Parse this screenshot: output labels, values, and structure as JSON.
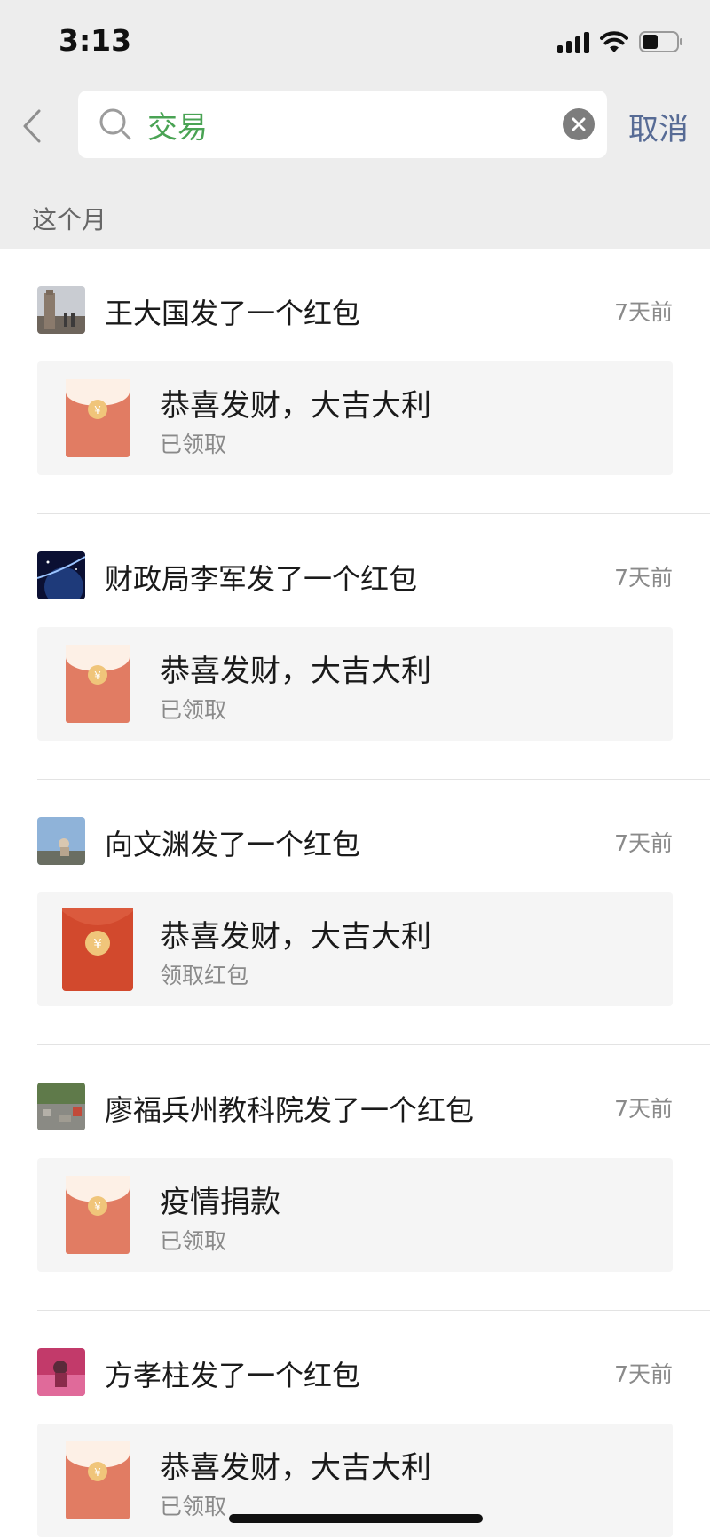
{
  "status_bar": {
    "time": "3:13"
  },
  "search": {
    "query": "交易",
    "cancel_label": "取消"
  },
  "section": {
    "label": "这个月"
  },
  "items": [
    {
      "sender": "王大国发了一个红包",
      "time": "7天前",
      "card_title": "恭喜发财，大吉大利",
      "card_status": "已领取",
      "opened": true,
      "avatar": "statue"
    },
    {
      "sender": "财政局李军发了一个红包",
      "time": "7天前",
      "card_title": "恭喜发财，大吉大利",
      "card_status": "已领取",
      "opened": true,
      "avatar": "space"
    },
    {
      "sender": "向文渊发了一个红包",
      "time": "7天前",
      "card_title": "恭喜发财，大吉大利",
      "card_status": "领取红包",
      "opened": false,
      "avatar": "sky"
    },
    {
      "sender": "廖福兵州教科院发了一个红包",
      "time": "7天前",
      "card_title": "疫情捐款",
      "card_status": "已领取",
      "opened": true,
      "avatar": "landscape"
    },
    {
      "sender": "方孝柱发了一个红包",
      "time": "7天前",
      "card_title": "恭喜发财，大吉大利",
      "card_status": "已领取",
      "opened": true,
      "avatar": "people"
    }
  ],
  "colors": {
    "search_text": "#4aa354",
    "cancel": "#576b95",
    "envelope_opened": "#e17c63",
    "envelope_unopened": "#d2492d",
    "coin": "#f0c57a"
  }
}
